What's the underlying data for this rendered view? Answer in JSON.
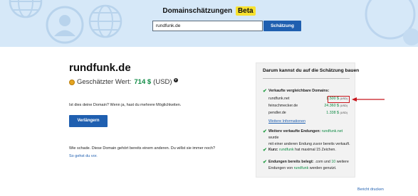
{
  "header": {
    "title": "Domainschätzungen",
    "badge": "Beta",
    "search_value": "rundfunk.de",
    "search_button": "Schätzung"
  },
  "domain": {
    "name": "rundfunk.de",
    "estimate_label": "Geschätzter Wert:",
    "estimate_value": "714 $",
    "estimate_currency": "(USD)",
    "info_symbol": "?"
  },
  "owner": {
    "question": "Ist dies deine Domain? Wenn ja, hast du mehrere Möglichkeiten.",
    "extend_button": "Verlängern",
    "taken_text": "Wie schade. Diese Domain gehört bereits einem anderen. Du willst sie immer noch?",
    "lookup_link": "So gehst du vor."
  },
  "panel": {
    "title": "Darum kannst du auf die Schätzung bauen",
    "comparable_title": "Verkaufte vergleichbare Domains:",
    "sales": [
      {
        "name": "rundfunk.net",
        "price": "1.500 $",
        "unit": "(USD)"
      },
      {
        "name": "feinschmecker.de",
        "price": "24.360 $",
        "unit": "(USD)"
      },
      {
        "name": "pendler.de",
        "price": "1.338 $",
        "unit": "(USD)"
      }
    ],
    "more_info": "Weitere Informationen",
    "endings": {
      "prefix": "Weitere verkaufte Endungen:",
      "highlight": "rundfunk.net",
      "line1_suffix": "wurde",
      "line2": "mit einer anderen Endung zuvor bereits verkauft."
    },
    "short": {
      "prefix": "Kurz:",
      "highlight": "rundfunk",
      "suffix": "hat maximal 15 Zeichen."
    },
    "taken_endings": {
      "prefix": "Endungen bereits belegt:",
      "text_a": ".com und",
      "count": "10",
      "text_b": "weitere",
      "line2_a": "Endungen von",
      "highlight": "rundfunk",
      "line2_b": "werden genutzt."
    }
  },
  "footer": {
    "print_link": "Bericht drucken"
  },
  "colors": {
    "header_bg": "#d6e8f8",
    "primary": "#1f5fb0",
    "value_green": "#0e8a43",
    "check_green": "#27a048",
    "highlight_red": "#c8161d",
    "beta_yellow": "#f7e12f"
  },
  "icons": [
    "globe-icon",
    "person-icon",
    "coin-icon",
    "info-icon",
    "check-icon",
    "arrow-left-icon"
  ]
}
